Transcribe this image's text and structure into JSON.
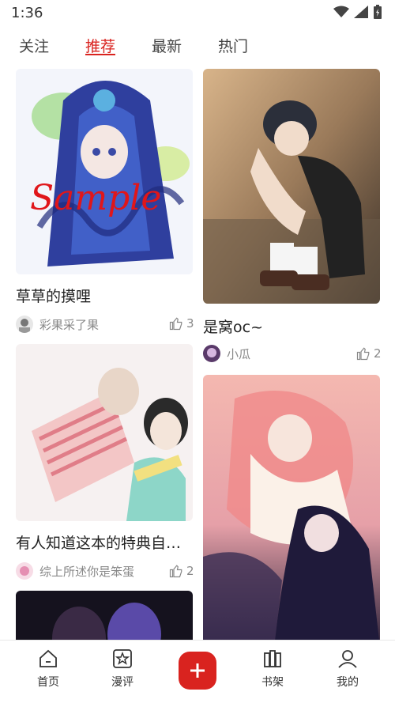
{
  "status": {
    "time": "1:36"
  },
  "tabs": [
    {
      "label": "关注"
    },
    {
      "label": "推荐"
    },
    {
      "label": "最新"
    },
    {
      "label": "热门"
    }
  ],
  "cards": [
    {
      "title": "草草的摸哩",
      "author": "彩果采了果",
      "likes": "3",
      "image_text": "Sample"
    },
    {
      "title": "是窝oc~",
      "author": "小瓜",
      "likes": "2"
    },
    {
      "title": "有人知道这本的特典自…",
      "author": "综上所述你是笨蛋",
      "likes": "2"
    }
  ],
  "bottom_nav": [
    {
      "label": "首页",
      "icon": "home-icon"
    },
    {
      "label": "漫评",
      "icon": "star-review-icon"
    },
    {
      "label": "书架",
      "icon": "bookshelf-icon"
    },
    {
      "label": "我的",
      "icon": "profile-icon"
    }
  ],
  "colors": {
    "accent": "#d9231f",
    "text_muted": "#888888"
  }
}
